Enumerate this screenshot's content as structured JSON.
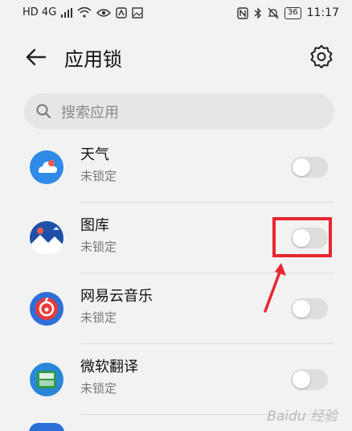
{
  "status_bar": {
    "left_indicators": "HD 4G",
    "battery": "36",
    "time": "11:17"
  },
  "header": {
    "title": "应用锁",
    "back_icon": "arrow-left-icon",
    "settings_icon": "gear-icon"
  },
  "search": {
    "placeholder": "搜索应用"
  },
  "apps": [
    {
      "name": "天气",
      "status": "未锁定",
      "locked": false,
      "icon": "weather-icon"
    },
    {
      "name": "图库",
      "status": "未锁定",
      "locked": false,
      "icon": "gallery-icon"
    },
    {
      "name": "网易云音乐",
      "status": "未锁定",
      "locked": false,
      "icon": "netease-music-icon"
    },
    {
      "name": "微软翻译",
      "status": "未锁定",
      "locked": false,
      "icon": "microsoft-translator-icon"
    }
  ],
  "annotation": {
    "highlight_color": "#e8262f"
  },
  "watermark": "Baidu 经验"
}
